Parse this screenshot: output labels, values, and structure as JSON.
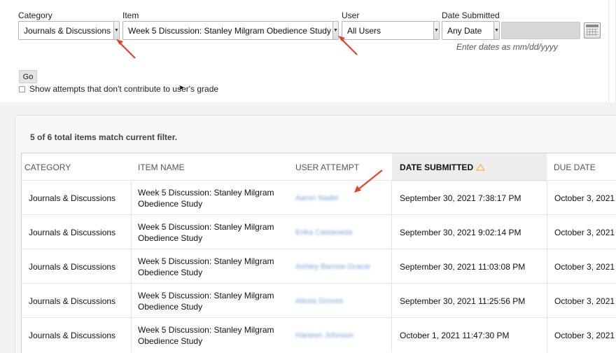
{
  "filters": {
    "category": {
      "label": "Category",
      "value": "Journals & Discussions"
    },
    "item": {
      "label": "Item",
      "value": "Week 5 Discussion: Stanley Milgram Obedience Study"
    },
    "user": {
      "label": "User",
      "value": "All Users"
    },
    "date": {
      "label": "Date Submitted",
      "value": "Any Date",
      "hint": "Enter dates as mm/dd/yyyy"
    },
    "go_label": "Go",
    "show_attempts_label": "Show attempts that don't contribute to user's grade"
  },
  "results": {
    "count_text": "5 of 6 total items match current filter.",
    "columns": [
      "CATEGORY",
      "ITEM NAME",
      "USER ATTEMPT",
      "DATE SUBMITTED",
      "DUE DATE"
    ],
    "rows": [
      {
        "category": "Journals & Discussions",
        "item_line1": "Week 5 Discussion: Stanley Milgram",
        "item_line2": "Obedience Study",
        "user": "Aaron Nadel",
        "date": "September 30, 2021 7:38:17 PM",
        "due": "October 3, 2021"
      },
      {
        "category": "Journals & Discussions",
        "item_line1": "Week 5 Discussion: Stanley Milgram",
        "item_line2": "Obedience Study",
        "user": "Erika Castaneda",
        "date": "September 30, 2021 9:02:14 PM",
        "due": "October 3, 2021"
      },
      {
        "category": "Journals & Discussions",
        "item_line1": "Week 5 Discussion: Stanley Milgram",
        "item_line2": "Obedience Study",
        "user": "Ashley Barrow-Gracie",
        "date": "September 30, 2021 11:03:08 PM",
        "due": "October 3, 2021"
      },
      {
        "category": "Journals & Discussions",
        "item_line1": "Week 5 Discussion: Stanley Milgram",
        "item_line2": "Obedience Study",
        "user": "Alexia Groves",
        "date": "September 30, 2021 11:25:56 PM",
        "due": "October 3, 2021"
      },
      {
        "category": "Journals & Discussions",
        "item_line1": "Week 5 Discussion: Stanley Milgram",
        "item_line2": "Obedience Study",
        "user": "Haneen Johnson",
        "date": "October 1, 2021 11:47:30 PM",
        "due": "October 3, 2021"
      }
    ]
  },
  "icons": {
    "calendar": "calendar-icon",
    "sort": "sort-ascending-icon",
    "annotation": "red-arrow"
  },
  "colors": {
    "annotation_arrow": "#e8402a",
    "sort_triangle": "#e8b84a",
    "blurred_link": "#7aa7d6"
  }
}
